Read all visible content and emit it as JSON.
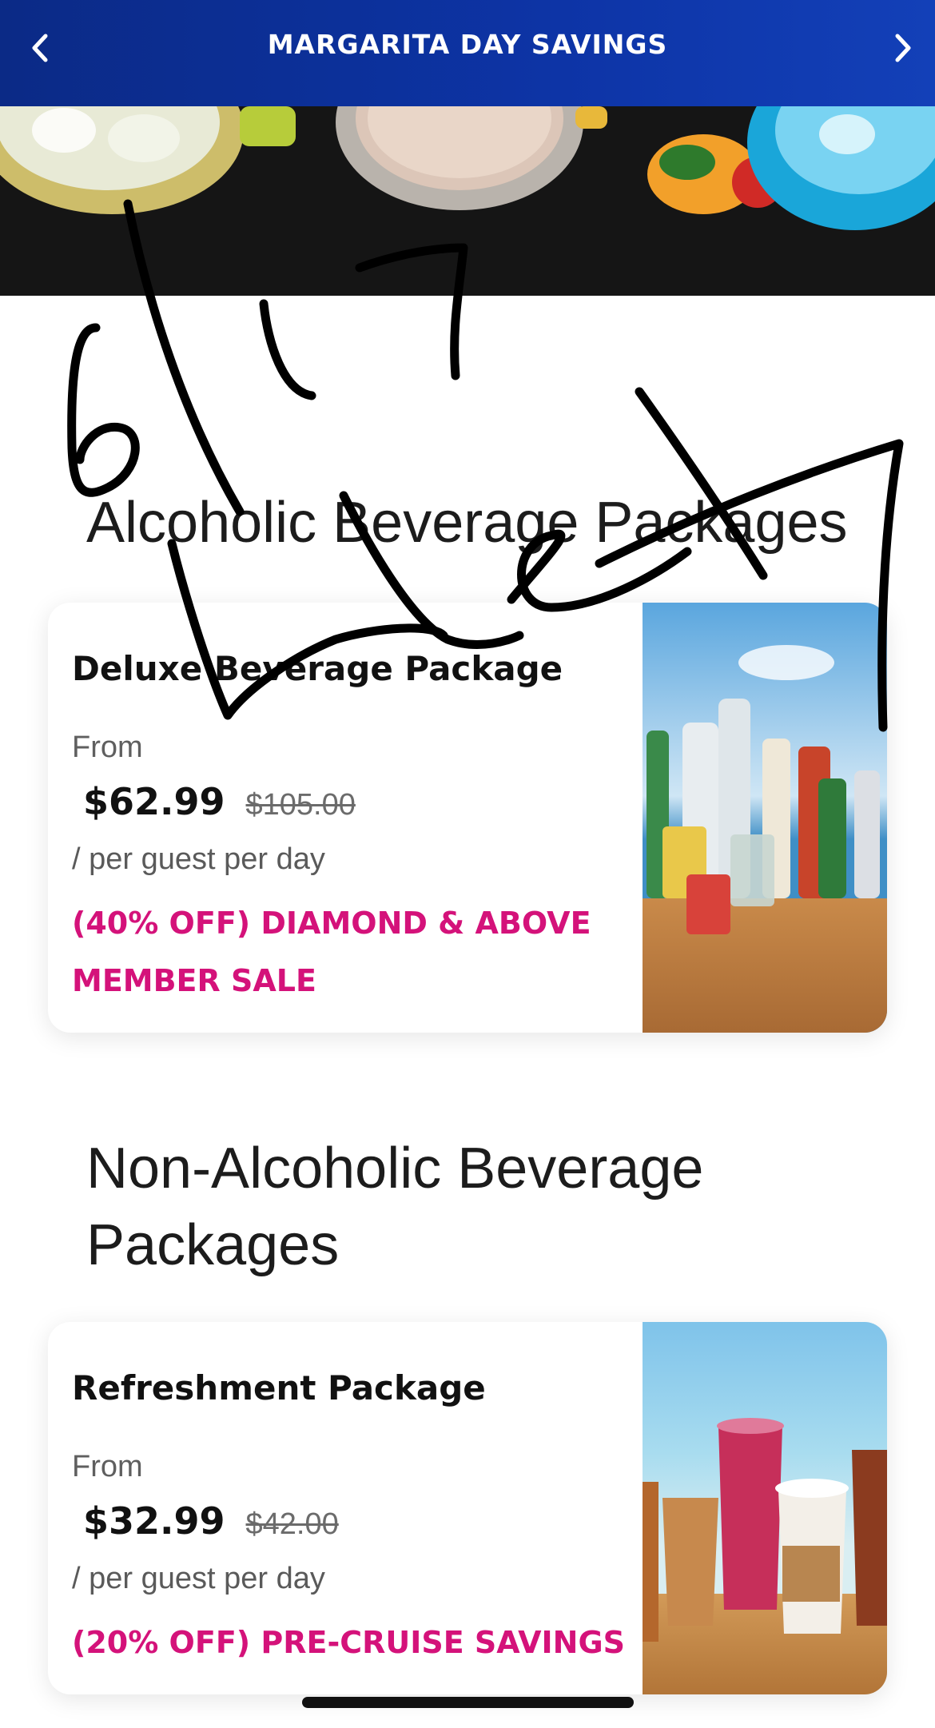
{
  "header": {
    "title": "MARGARITA DAY SAVINGS",
    "prev_icon": "chevron-left-icon",
    "next_icon": "chevron-right-icon"
  },
  "sections": [
    {
      "title": "Alcoholic Beverage Packages",
      "card": {
        "name": "Deluxe Beverage Package",
        "from_label": "From",
        "price": "$62.99",
        "old_price": "$105.00",
        "per_label": "/ per guest per day",
        "promo": "(40% OFF) DIAMOND & ABOVE MEMBER SALE"
      }
    },
    {
      "title_line1": "Non-Alcoholic Beverage",
      "title_line2": "Packages",
      "card": {
        "name": "Refreshment Package",
        "from_label": "From",
        "price": "$32.99",
        "old_price": "$42.00",
        "per_label": "/ per guest per day",
        "promo": "(20% OFF) PRE-CRUISE SAVINGS"
      }
    }
  ],
  "colors": {
    "header_bg": "#0d34a6",
    "promo": "#d4127a"
  }
}
